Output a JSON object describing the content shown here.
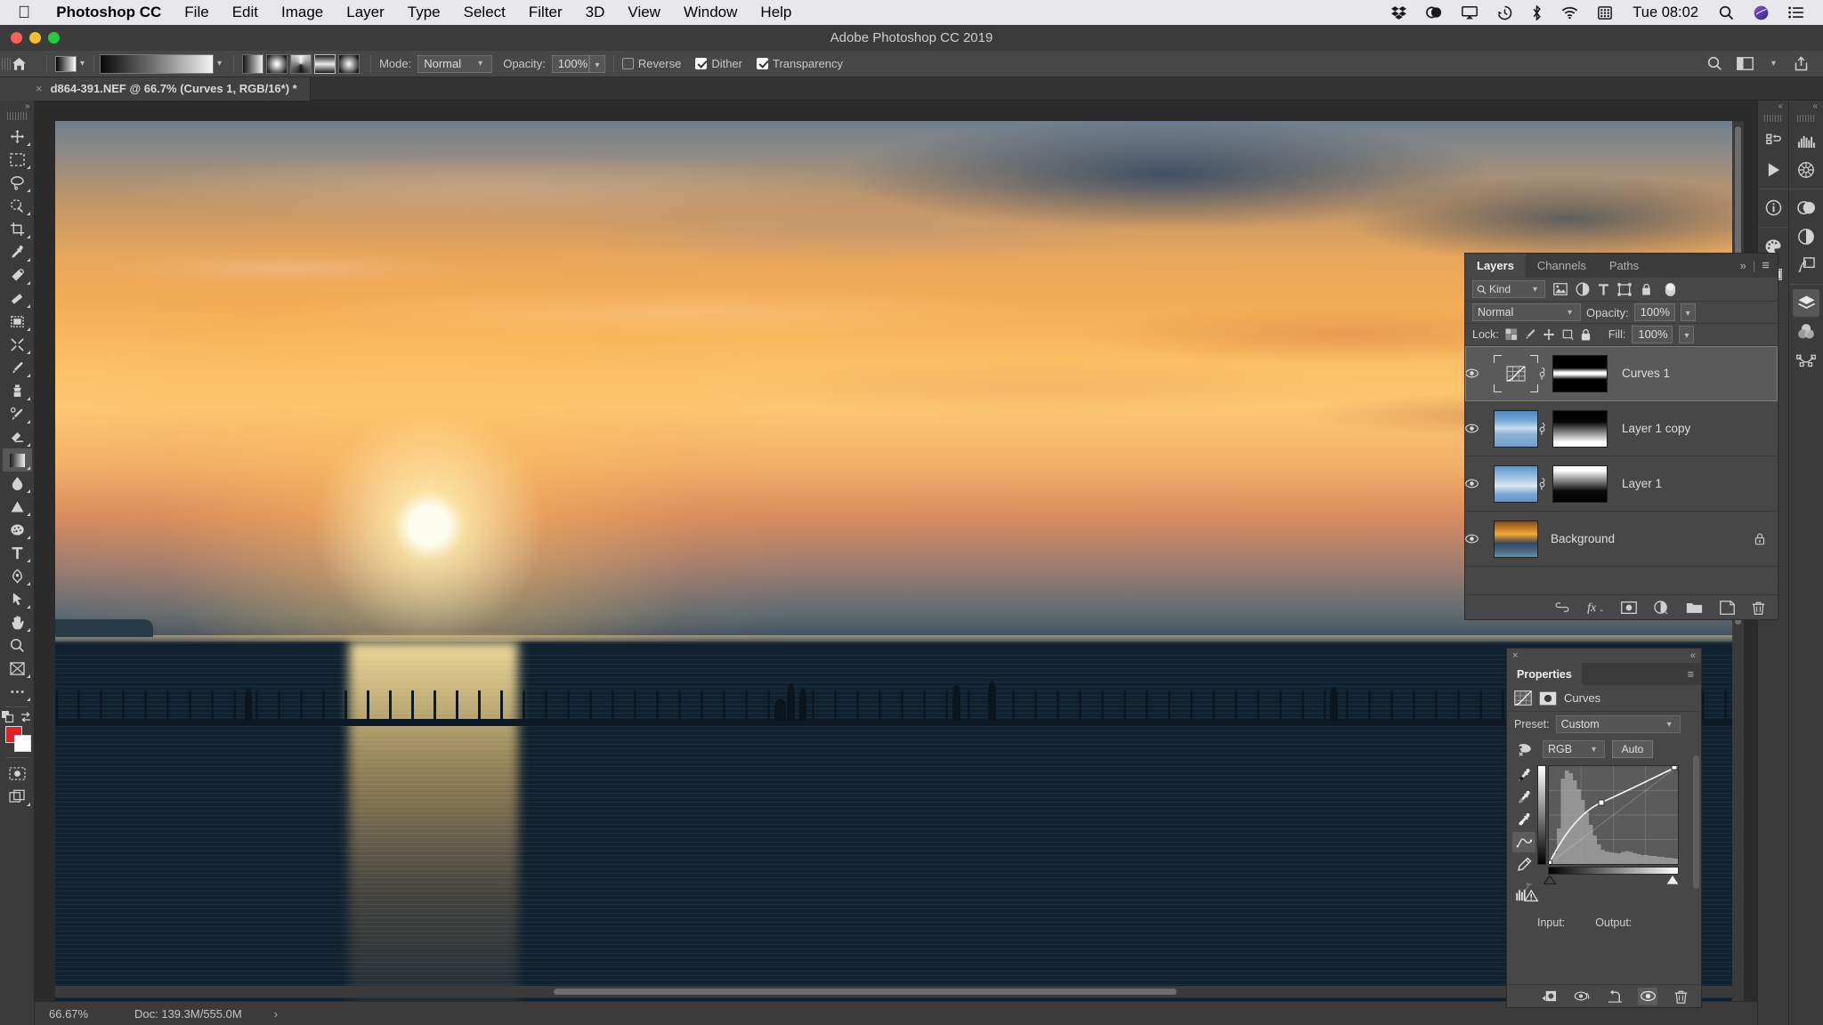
{
  "menubar": {
    "apple_icon": "apple-icon",
    "app_name": "Photoshop CC",
    "items": [
      "File",
      "Edit",
      "Image",
      "Layer",
      "Type",
      "Select",
      "Filter",
      "3D",
      "View",
      "Window",
      "Help"
    ],
    "status_icons": [
      "dropbox-icon",
      "creative-cloud-icon",
      "airplay-icon",
      "time-machine-icon",
      "bluetooth-icon",
      "wifi-icon",
      "display-icon"
    ],
    "clock": "Tue 08:02",
    "right_icons": [
      "spotlight-search-icon",
      "siri-icon",
      "control-center-icon"
    ]
  },
  "window": {
    "title": "Adobe Photoshop CC 2019",
    "traffic_lights": [
      "close",
      "minimize",
      "zoom"
    ],
    "light_colors": [
      "#ff5f57",
      "#febc2e",
      "#28c840"
    ]
  },
  "options_bar": {
    "home_icon": "home-icon",
    "tool_preset_icon": "gradient-preset-icon",
    "gradient_swatch": "gradient-swatch",
    "gradient_types": [
      "linear-gradient-icon",
      "radial-gradient-icon",
      "angle-gradient-icon",
      "reflected-gradient-icon",
      "diamond-gradient-icon"
    ],
    "selected_gradient_type_index": 3,
    "mode_label": "Mode:",
    "mode_value": "Normal",
    "opacity_label": "Opacity:",
    "opacity_value": "100%",
    "reverse_label": "Reverse",
    "reverse_checked": false,
    "dither_label": "Dither",
    "dither_checked": true,
    "transparency_label": "Transparency",
    "transparency_checked": true,
    "right_icons": [
      "search-icon",
      "workspace-icon",
      "share-icon"
    ]
  },
  "document": {
    "tab_title": "d864-391.NEF @ 66.7% (Curves 1, RGB/16*) *",
    "close_glyph": "×"
  },
  "toolbar": {
    "collapse_glyph": "»",
    "tools": [
      {
        "name": "move-tool",
        "icon": "move-icon"
      },
      {
        "name": "marquee-tool",
        "icon": "rect-marquee-icon"
      },
      {
        "name": "lasso-tool",
        "icon": "lasso-icon"
      },
      {
        "name": "quick-selection-tool",
        "icon": "quick-selection-icon"
      },
      {
        "name": "crop-tool",
        "icon": "crop-icon"
      },
      {
        "name": "eyedropper-tool",
        "icon": "eyedropper-icon"
      },
      {
        "name": "spot-healing-tool",
        "icon": "healing-brush-icon"
      },
      {
        "name": "patch-tool",
        "icon": "patch-icon"
      },
      {
        "name": "frame-tool",
        "icon": "frame-icon"
      },
      {
        "name": "content-aware-move-tool",
        "icon": "content-aware-move-icon"
      },
      {
        "name": "brush-tool",
        "icon": "brush-icon"
      },
      {
        "name": "clone-stamp-tool",
        "icon": "clone-stamp-icon"
      },
      {
        "name": "history-brush-tool",
        "icon": "history-brush-icon"
      },
      {
        "name": "eraser-tool",
        "icon": "eraser-icon"
      },
      {
        "name": "gradient-tool",
        "icon": "gradient-icon",
        "active": true
      },
      {
        "name": "blur-tool",
        "icon": "blur-drop-icon"
      },
      {
        "name": "dodge-tool",
        "icon": "dodge-icon"
      },
      {
        "name": "sponge-tool",
        "icon": "sponge-icon"
      },
      {
        "name": "type-tool",
        "icon": "type-icon"
      },
      {
        "name": "pen-tool",
        "icon": "pen-icon"
      },
      {
        "name": "path-selection-tool",
        "icon": "path-arrow-icon"
      },
      {
        "name": "hand-tool",
        "icon": "hand-icon"
      },
      {
        "name": "zoom-tool",
        "icon": "magnifier-icon"
      },
      {
        "name": "slice-tool",
        "icon": "slice-icon"
      },
      {
        "name": "edit-toolbar",
        "icon": "ellipsis-icon"
      }
    ],
    "swap_colors_icon": "swap-colors-icon",
    "default_colors_icon": "default-colors-icon",
    "foreground_color": "#ec1c24",
    "background_color": "#ffffff",
    "quick_mask_icon": "quick-mask-icon",
    "screen_mode_icon": "screen-mode-icon"
  },
  "status_bar": {
    "zoom": "66.67%",
    "doc_info": "Doc: 139.3M/555.0M",
    "arrow_glyph": "›"
  },
  "rail_inner": {
    "collapse_glyph": "«",
    "items": [
      {
        "name": "history-panel-icon",
        "label": "History"
      },
      {
        "name": "actions-panel-icon",
        "label": "Actions"
      },
      {
        "name": "info-panel-icon",
        "label": "Info"
      },
      {
        "name": "swatches-panel-icon",
        "label": "Swatches"
      },
      {
        "name": "gradients-panel-icon",
        "label": "Gradients"
      }
    ]
  },
  "rail_outer": {
    "collapse_glyph": "«",
    "items": [
      {
        "name": "histogram-panel-icon",
        "label": "Histogram"
      },
      {
        "name": "navigator-panel-icon",
        "label": "Navigator"
      },
      {
        "name": "libraries-panel-icon",
        "label": "Libraries"
      },
      {
        "name": "adjustments-panel-icon",
        "label": "Adjustments"
      },
      {
        "name": "styles-panel-icon",
        "label": "Styles"
      },
      {
        "name": "layers-panel-icon",
        "label": "Layers",
        "selected": true
      },
      {
        "name": "channels-panel-icon",
        "label": "Channels"
      },
      {
        "name": "paths-panel-icon",
        "label": "Paths"
      }
    ]
  },
  "layers_panel": {
    "tabs": [
      {
        "label": "Layers",
        "active": true
      },
      {
        "label": "Channels",
        "active": false
      },
      {
        "label": "Paths",
        "active": false
      }
    ],
    "expand_glyph": "»",
    "menu_glyph": "≡",
    "filter": {
      "search_icon": "search-icon",
      "kind_label": "Kind",
      "caret": "⌄",
      "type_filters": [
        "pixel-filter-icon",
        "adjustment-filter-icon",
        "type-filter-icon",
        "shape-filter-icon",
        "smart-object-filter-icon"
      ],
      "toggle_icon": "filter-toggle-icon"
    },
    "blend_mode": "Normal",
    "opacity_label": "Opacity:",
    "opacity_value": "100%",
    "lock_label": "Lock:",
    "lock_icons": [
      "lock-transparent-icon",
      "lock-image-icon",
      "lock-position-icon",
      "lock-artboard-icon",
      "lock-all-icon"
    ],
    "fill_label": "Fill:",
    "fill_value": "100%",
    "layers": [
      {
        "name": "Curves 1",
        "visible": true,
        "selected": true,
        "thumb": "adjustment-curves",
        "has_mask": true,
        "mask_style": "m1",
        "linked": true,
        "locked": false
      },
      {
        "name": "Layer 1 copy",
        "visible": true,
        "selected": false,
        "thumb": "sky-a",
        "has_mask": true,
        "mask_style": "m2",
        "linked": true,
        "locked": false
      },
      {
        "name": "Layer 1",
        "visible": true,
        "selected": false,
        "thumb": "sky-b",
        "has_mask": true,
        "mask_style": "m3",
        "linked": true,
        "locked": false
      },
      {
        "name": "Background",
        "visible": true,
        "selected": false,
        "thumb": "sunset",
        "has_mask": false,
        "mask_style": "",
        "linked": false,
        "locked": true
      }
    ],
    "footer_icons": [
      "link-layers-icon",
      "layer-style-fx-icon",
      "add-mask-icon",
      "new-adjustment-icon",
      "new-group-icon",
      "new-layer-icon",
      "delete-layer-icon"
    ],
    "eye_glyph": "◉",
    "link_glyph": "⚭",
    "lock_glyph": "🔒"
  },
  "properties_panel": {
    "close_glyph": "×",
    "collapse_glyph": "«",
    "tab_label": "Properties",
    "menu_glyph": "≡",
    "adjustment_icon": "curves-icon",
    "mask_icon": "layer-mask-icon",
    "adjustment_title": "Curves",
    "preset_label": "Preset:",
    "preset_value": "Custom",
    "caret": "⌄",
    "channel_value": "RGB",
    "auto_label": "Auto",
    "on_image_icon": "on-image-adjust-icon",
    "tools": [
      {
        "name": "set-black-point-eyedropper",
        "icon": "eyedropper-black-icon"
      },
      {
        "name": "set-gray-point-eyedropper",
        "icon": "eyedropper-gray-icon"
      },
      {
        "name": "set-white-point-eyedropper",
        "icon": "eyedropper-white-icon"
      },
      {
        "name": "edit-points-curve-tool",
        "icon": "curve-points-icon",
        "selected": true
      },
      {
        "name": "draw-curve-pencil-tool",
        "icon": "pencil-icon"
      },
      {
        "name": "smooth-curve-button",
        "icon": "smooth-curve-icon",
        "disabled": true
      }
    ],
    "input_label": "Input:",
    "output_label": "Output:",
    "input_value": "",
    "output_value": "",
    "histogram_warning_icon": "histogram-warning-icon",
    "footer_icons": [
      "clip-to-layer-icon",
      "view-previous-state-icon",
      "reset-adjustment-icon",
      "toggle-visibility-icon",
      "delete-adjustment-icon"
    ]
  },
  "chart_data": {
    "type": "line",
    "title": "Curves (RGB)",
    "xlabel": "Input",
    "ylabel": "Output",
    "xlim": [
      0,
      255
    ],
    "ylim": [
      0,
      255
    ],
    "grid": true,
    "control_points": [
      {
        "input": 0,
        "output": 0
      },
      {
        "input": 104,
        "output": 160
      },
      {
        "input": 255,
        "output": 255
      }
    ],
    "curve": [
      {
        "input": 0,
        "output": 0
      },
      {
        "input": 32,
        "output": 62
      },
      {
        "input": 64,
        "output": 112
      },
      {
        "input": 104,
        "output": 160
      },
      {
        "input": 140,
        "output": 193
      },
      {
        "input": 180,
        "output": 220
      },
      {
        "input": 220,
        "output": 241
      },
      {
        "input": 255,
        "output": 255
      }
    ],
    "histogram": [
      2,
      6,
      18,
      58,
      96,
      92,
      84,
      78,
      70,
      62,
      50,
      38,
      26,
      18,
      14,
      12,
      11,
      10,
      12,
      14,
      12,
      10,
      9,
      8,
      8,
      7,
      7,
      6,
      6,
      5,
      5,
      4
    ],
    "black_point": 0,
    "white_point": 255
  }
}
